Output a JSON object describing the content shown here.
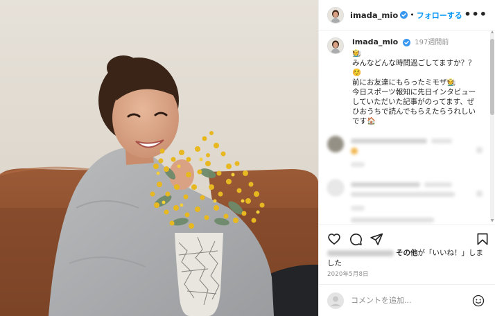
{
  "post": {
    "username": "imada_mio",
    "follow_label": "フォローする",
    "separator": "•",
    "more_label": "•••",
    "caption": {
      "time": "197週間前",
      "text": "🧑‍🌾\nみんなどんな時間過ごしてますか？？\n☺️\n前にお友達にもらったミモザ🧑‍🌾\n今日スポーツ報知に先日インタビュー\nしていただいた記事がのってます、ぜ\nひおうちで読んでもらえたらうれしい\nです🏠"
    },
    "likes_text": "その他が「いいね！」しま\nした",
    "likes_bold": "その他",
    "likes_rest": "が「いいね！」しま",
    "likes_rest2": "した",
    "date": "2020年5月8日",
    "comment_placeholder": "コメントを追加...",
    "colors": {
      "accent": "#0095f6",
      "verified": "#3897f0",
      "secondary_text": "#8e8e8e"
    },
    "icons": {
      "like": "heart-icon",
      "comment": "comment-icon",
      "share": "paper-plane-icon",
      "save": "bookmark-icon",
      "emoji": "smiley-icon",
      "verified": "verified-badge-icon",
      "more": "more-options-icon"
    }
  }
}
